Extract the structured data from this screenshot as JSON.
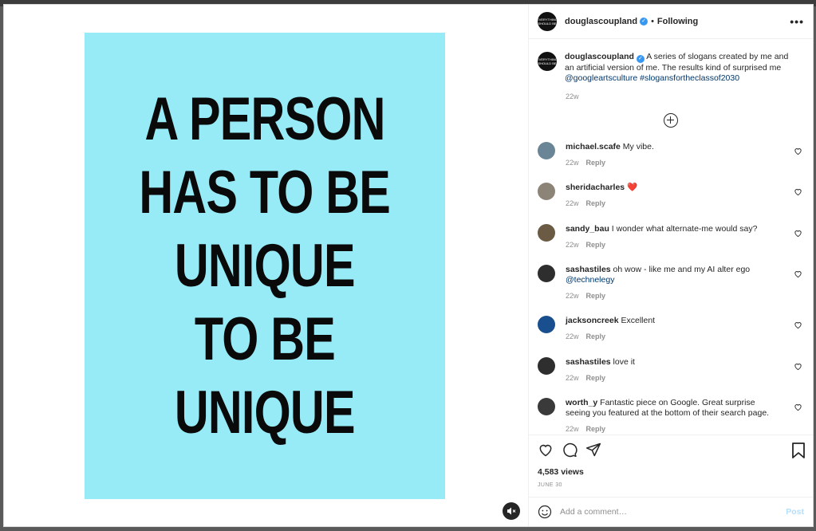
{
  "colors": {
    "poster_bg": "#97ebf6",
    "link": "#00376b",
    "verified": "#3897f0",
    "muted_text": "#8e8e8e",
    "post_disabled": "#b2dffc"
  },
  "post": {
    "image_text_lines": [
      "A PERSON",
      "HAS TO BE",
      "UNIQUE",
      "TO BE",
      "UNIQUE"
    ]
  },
  "header": {
    "username": "douglascoupland",
    "follow_status": "Following",
    "separator": "•",
    "more_label": "•••",
    "avatar_text": "EVERYTHING SHOULD BE"
  },
  "caption": {
    "username": "douglascoupland",
    "text": " A series of slogans created by me and an artificial version of me. The results kind of surprised me ",
    "mention": "@googleartsculture",
    "hashtag": " #slogansfortheclassof2030",
    "time": "22w"
  },
  "comments": [
    {
      "username": "michael.scafe",
      "text": " My vibe.",
      "mention": "",
      "time": "22w",
      "reply_label": "Reply",
      "avatar_color": "#6a8596"
    },
    {
      "username": "sheridacharles",
      "text": " ❤️",
      "mention": "",
      "time": "22w",
      "reply_label": "Reply",
      "avatar_color": "#8d8478"
    },
    {
      "username": "sandy_bau",
      "text": " I wonder what alternate-me would say?",
      "mention": "",
      "time": "22w",
      "reply_label": "Reply",
      "avatar_color": "#6b5a44"
    },
    {
      "username": "sashastiles",
      "text": " oh wow - like me and my AI alter ego ",
      "mention": "@technelegy",
      "time": "22w",
      "reply_label": "Reply",
      "avatar_color": "#2e2e2e"
    },
    {
      "username": "jacksoncreek",
      "text": " Excellent",
      "mention": "",
      "time": "22w",
      "reply_label": "Reply",
      "avatar_color": "#1a4f8f"
    },
    {
      "username": "sashastiles",
      "text": " love it",
      "mention": "",
      "time": "22w",
      "reply_label": "Reply",
      "avatar_color": "#2e2e2e"
    },
    {
      "username": "worth_y",
      "text": " Fantastic piece on Google. Great surprise seeing you featured at the bottom of their search page.",
      "mention": "",
      "time": "22w",
      "reply_label": "Reply",
      "avatar_color": "#3a3a3a"
    }
  ],
  "stats": {
    "views": "4,583 views",
    "date": "JUNE 30"
  },
  "composer": {
    "placeholder": "Add a comment…",
    "post_label": "Post"
  },
  "icons": [
    "mute-icon",
    "plus-circle-icon",
    "heart-icon",
    "comment-icon",
    "share-icon",
    "bookmark-icon",
    "emoji-icon",
    "more-icon",
    "verified-icon"
  ]
}
